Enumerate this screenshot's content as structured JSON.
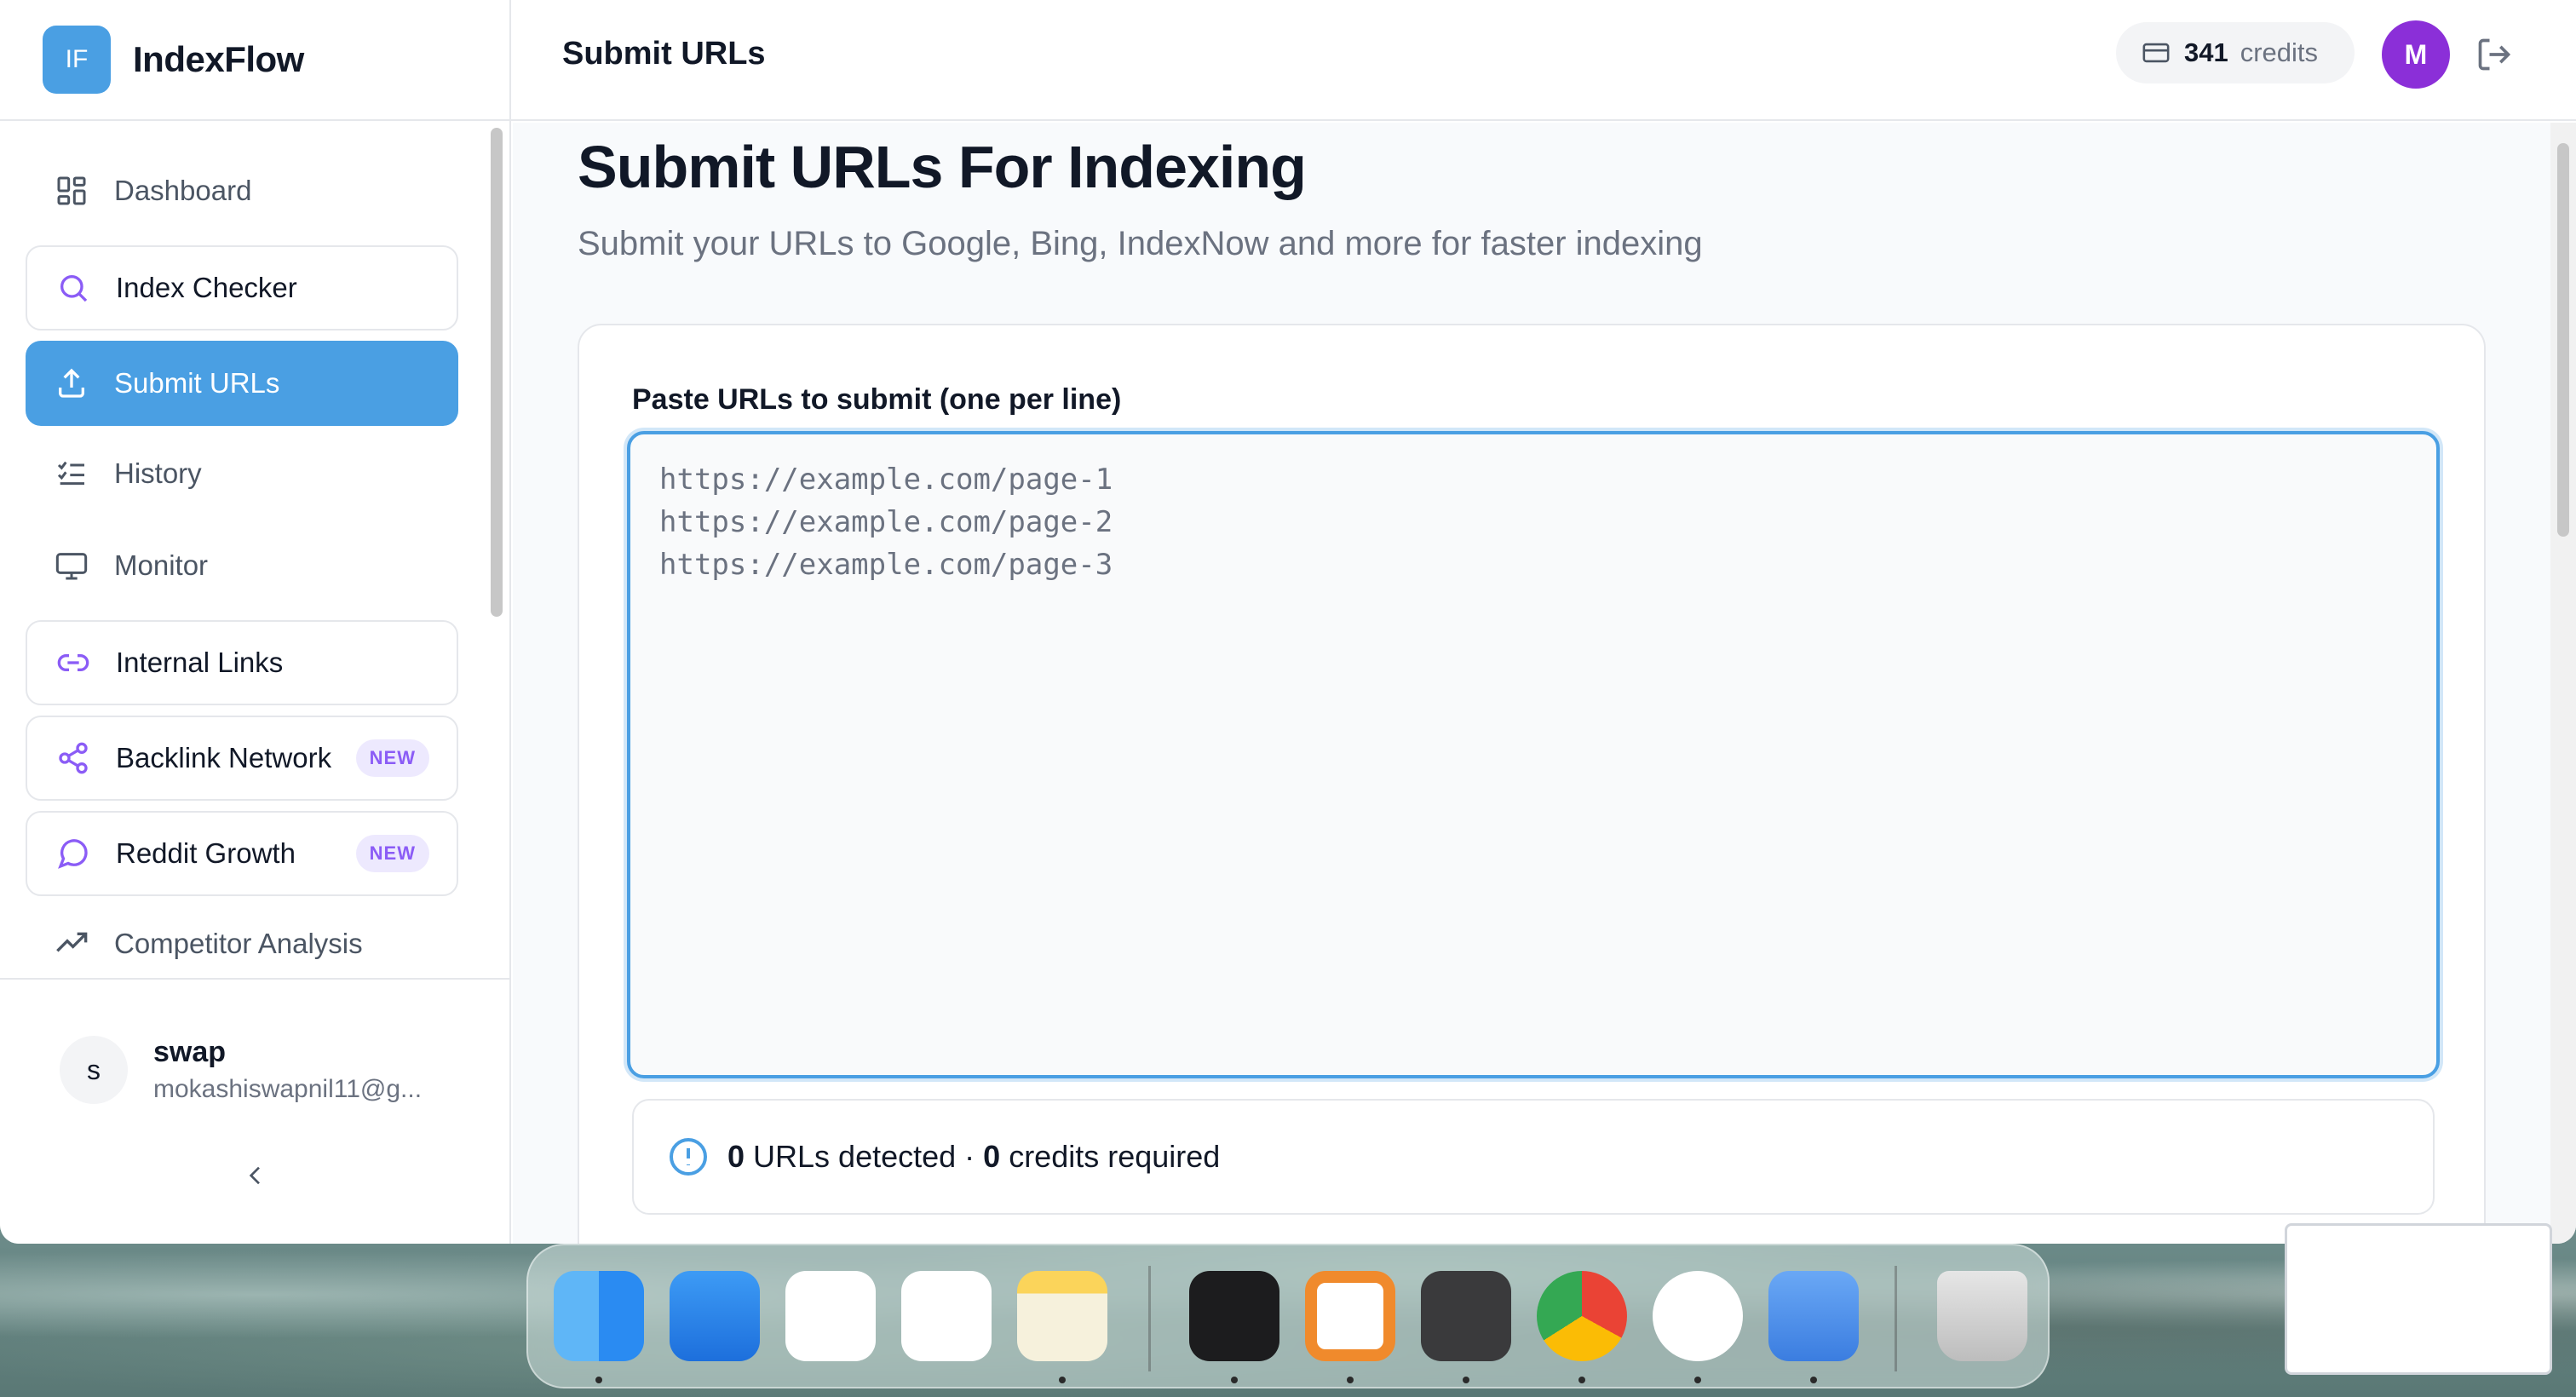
{
  "app": {
    "logo_text": "IF",
    "name": "IndexFlow"
  },
  "header": {
    "title": "Submit URLs",
    "credits_value": "341",
    "credits_label": "credits",
    "avatar_initial": "M"
  },
  "sidebar": {
    "items": [
      {
        "label": "Dashboard",
        "icon": "dashboard-icon"
      },
      {
        "label": "Index Checker",
        "icon": "search-icon"
      },
      {
        "label": "Submit URLs",
        "icon": "upload-icon"
      },
      {
        "label": "History",
        "icon": "checklist-icon"
      },
      {
        "label": "Monitor",
        "icon": "monitor-icon"
      },
      {
        "label": "Internal Links",
        "icon": "link-icon"
      },
      {
        "label": "Backlink Network",
        "icon": "share-icon",
        "badge": "NEW"
      },
      {
        "label": "Reddit Growth",
        "icon": "chat-icon",
        "badge": "NEW"
      },
      {
        "label": "Competitor Analysis",
        "icon": "trending-up-icon"
      }
    ],
    "user": {
      "initial": "s",
      "name": "swap",
      "email": "mokashiswapnil11@g..."
    }
  },
  "main": {
    "title": "Submit URLs For Indexing",
    "subtitle": "Submit your URLs to Google, Bing, IndexNow and more for faster indexing",
    "field_label": "Paste URLs to submit (one per line)",
    "placeholder": "https://example.com/page-1\nhttps://example.com/page-2\nhttps://example.com/page-3",
    "urls_count": "0",
    "urls_text": " URLs detected · ",
    "credits_count": "0",
    "credits_text": " credits required"
  },
  "colors": {
    "accent": "#4a9fe3",
    "avatar": "#8b2fd8",
    "badge": "#8b5cf6"
  },
  "dock": [
    "finder-icon",
    "keynote-icon",
    "reminders-icon",
    "slack-icon",
    "notes-icon",
    "terminal-icon",
    "openvpn-icon",
    "sublime-text-icon",
    "chrome-icon",
    "simulator-icon",
    "preview-icon",
    "trash-icon"
  ]
}
